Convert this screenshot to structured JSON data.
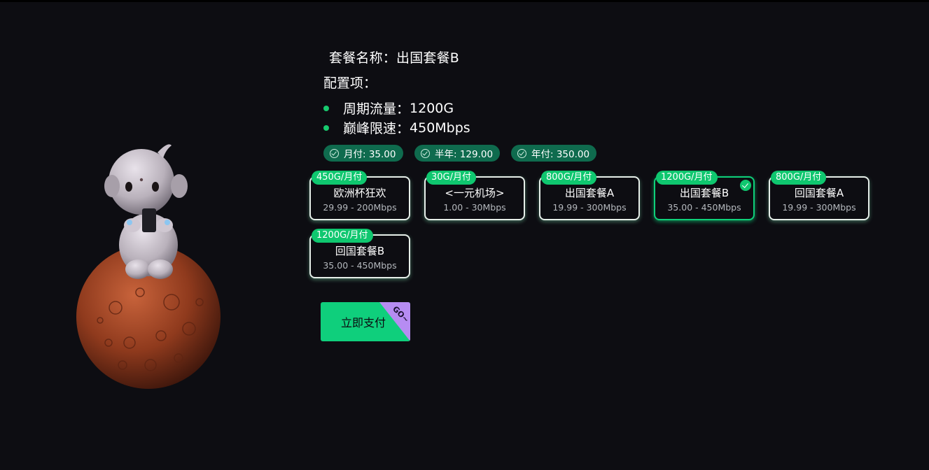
{
  "plan": {
    "name_line": "套餐名称：出国套餐B",
    "config_label": "配置项：",
    "features": [
      {
        "label": "周期流量：",
        "value": "1200G"
      },
      {
        "label": "巅峰限速：",
        "value": "450Mbps"
      }
    ]
  },
  "pricing": [
    {
      "label": "月付: 35.00"
    },
    {
      "label": "半年: 129.00"
    },
    {
      "label": "年付: 350.00"
    }
  ],
  "packages": [
    {
      "tag": "450G/月付",
      "name": "欧洲杯狂欢",
      "spec": "29.99 - 200Mbps",
      "selected": false
    },
    {
      "tag": "30G/月付",
      "name": "<一元机场>",
      "spec": "1.00 - 30Mbps",
      "selected": false
    },
    {
      "tag": "800G/月付",
      "name": "出国套餐A",
      "spec": "19.99 - 300Mbps",
      "selected": false
    },
    {
      "tag": "1200G/月付",
      "name": "出国套餐B",
      "spec": "35.00 - 450Mbps",
      "selected": true
    },
    {
      "tag": "800G/月付",
      "name": "回国套餐A",
      "spec": "19.99 - 300Mbps",
      "selected": false
    },
    {
      "tag": "1200G/月付",
      "name": "回国套餐B",
      "spec": "35.00 - 450Mbps",
      "selected": false
    }
  ],
  "actions": {
    "pay_label": "立即支付",
    "pay_ribbon": "GO~"
  },
  "icons": {
    "hero": "astronaut-on-planet-illustration",
    "price_option": "check-circle-icon",
    "selected_package": "check-badge-icon"
  },
  "colors": {
    "background": "#0d0d12",
    "accent": "#0fc76f",
    "price_pill": "#0f6b4e",
    "ribbon": "#b68cf2"
  }
}
